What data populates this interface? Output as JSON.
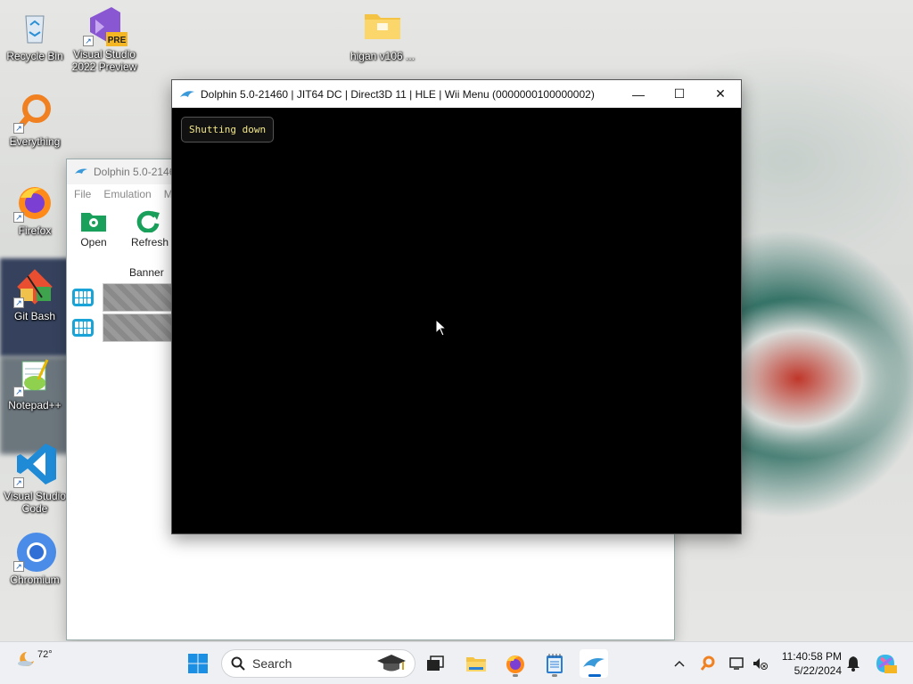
{
  "desktop": {
    "icons": [
      {
        "label": "Recycle Bin",
        "icon": "recycle-bin-icon"
      },
      {
        "label": "Visual Studio 2022 Preview",
        "icon": "visual-studio-preview-icon",
        "badge": "PRE"
      },
      {
        "label": "higan v106 ...",
        "icon": "folder-icon"
      },
      {
        "label": "Everything",
        "icon": "everything-search-icon"
      },
      {
        "label": "Firefox",
        "icon": "firefox-icon"
      },
      {
        "label": "Git Bash",
        "icon": "git-bash-icon"
      },
      {
        "label": "Notepad++",
        "icon": "notepad-plus-plus-icon"
      },
      {
        "label": "Visual Studio Code",
        "icon": "vscode-icon"
      },
      {
        "label": "Chromium",
        "icon": "chromium-icon"
      }
    ]
  },
  "main_window": {
    "title": "Dolphin 5.0-2146",
    "menu": [
      "File",
      "Emulation",
      "M"
    ],
    "toolbar": {
      "open_label": "Open",
      "refresh_label": "Refresh"
    },
    "table": {
      "column_banner": "Banner"
    }
  },
  "render_window": {
    "title": "Dolphin 5.0-21460 | JIT64 DC | Direct3D 11 | HLE | Wii Menu (0000000100000002)",
    "osd_message": "Shutting down",
    "buttons": {
      "minimize": "—",
      "maximize": "☐",
      "close": "✕"
    }
  },
  "taskbar": {
    "weather_temp": "72°",
    "search_placeholder": "Search",
    "clock_time": "11:40:58 PM",
    "clock_date": "5/22/2024"
  },
  "colors": {
    "osd_text": "#f4e88a",
    "accent": "#0a66c8",
    "wii_icon": "#1aa3d6"
  }
}
